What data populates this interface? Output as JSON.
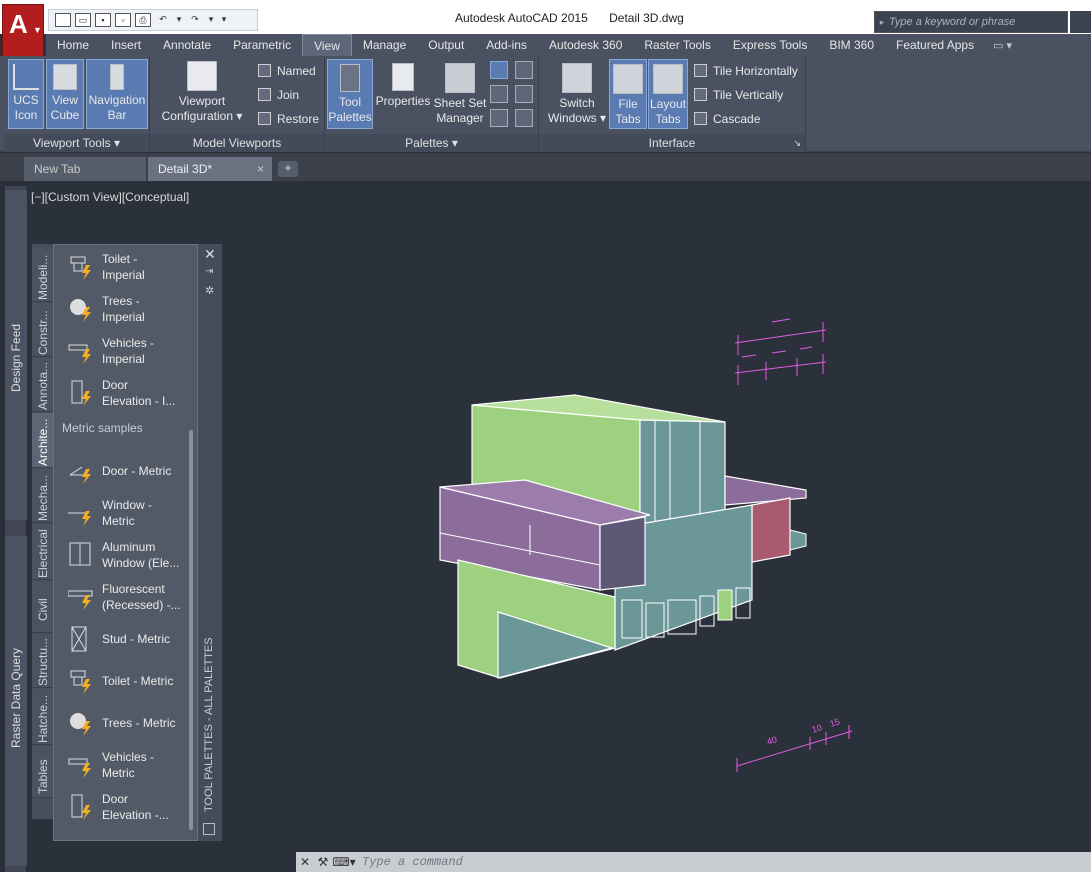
{
  "title": {
    "app": "Autodesk AutoCAD 2015",
    "file": "Detail 3D.dwg"
  },
  "search": {
    "placeholder": "Type a keyword or phrase"
  },
  "menu_tabs": [
    "Home",
    "Insert",
    "Annotate",
    "Parametric",
    "View",
    "Manage",
    "Output",
    "Add-ins",
    "Autodesk 360",
    "Raster Tools",
    "Express Tools",
    "BIM 360",
    "Featured Apps"
  ],
  "ribbon": {
    "viewport_tools": {
      "title": "Viewport Tools",
      "ucs": [
        "UCS",
        "Icon"
      ],
      "viewcube": [
        "View",
        "Cube"
      ],
      "navbar": [
        "Navigation",
        "Bar"
      ]
    },
    "model_viewports": {
      "title": "Model Viewports",
      "config": [
        "Viewport",
        "Configuration"
      ],
      "named": "Named",
      "join": "Join",
      "restore": "Restore"
    },
    "palettes": {
      "title": "Palettes",
      "tool": [
        "Tool",
        "Palettes"
      ],
      "properties": "Properties",
      "sheetset": [
        "Sheet Set",
        "Manager"
      ]
    },
    "interface": {
      "title": "Interface",
      "switch": [
        "Switch",
        "Windows"
      ],
      "filetabs": [
        "File",
        "Tabs"
      ],
      "layouttabs": [
        "Layout",
        "Tabs"
      ],
      "tile_h": "Tile Horizontally",
      "tile_v": "Tile Vertically",
      "cascade": "Cascade"
    }
  },
  "file_tabs": {
    "new": "New Tab",
    "active": "Detail 3D*",
    "close": "×",
    "add": "+"
  },
  "view_label": "[−][Custom View][Conceptual]",
  "left_strip": {
    "design_feed": "Design Feed",
    "raster": "Raster Data Query"
  },
  "palette": {
    "title": "TOOL PALETTES - ALL PALETTES",
    "tabs": [
      "Modeli...",
      "Constr...",
      "Annota...",
      "Archite...",
      "Mecha...",
      "Electrical",
      "Civil",
      "Structu...",
      "Hatche...",
      "Tables"
    ],
    "items_top": [
      [
        "Toilet -",
        "Imperial"
      ],
      [
        "Trees -",
        "Imperial"
      ],
      [
        "Vehicles -",
        "Imperial"
      ],
      [
        "Door",
        "Elevation - I..."
      ]
    ],
    "section": "Metric samples",
    "items_metric": [
      [
        "Door - Metric",
        ""
      ],
      [
        "Window -",
        "Metric"
      ],
      [
        "Aluminum",
        "Window (Ele..."
      ],
      [
        "Fluorescent",
        "(Recessed) -..."
      ],
      [
        "Stud - Metric",
        ""
      ],
      [
        "Toilet - Metric",
        ""
      ],
      [
        "Trees - Metric",
        ""
      ],
      [
        "Vehicles -",
        "Metric"
      ],
      [
        "Door",
        "Elevation -..."
      ]
    ]
  },
  "dimensions": {
    "d40": "40",
    "d10": "10",
    "d15": "15"
  },
  "command": {
    "placeholder": "Type a command"
  },
  "colors": {
    "green": "#9dd17f",
    "teal": "#6b9798",
    "purple": "#8c6c9b",
    "magenta": "#e05ce0"
  }
}
